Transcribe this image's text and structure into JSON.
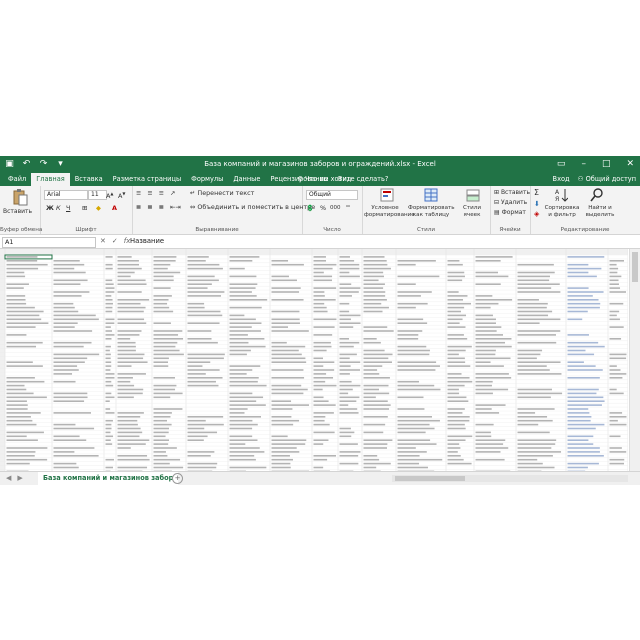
{
  "app": {
    "title": "База компаний и магазинов заборов и ограждений.xlsx - Excel",
    "quick_access": [
      "save",
      "undo",
      "redo",
      "more"
    ],
    "window_controls": [
      "ribbon-options",
      "minimize",
      "restore",
      "close"
    ]
  },
  "tabs": [
    "Файл",
    "Главная",
    "Вставка",
    "Разметка страницы",
    "Формулы",
    "Данные",
    "Рецензирование",
    "Вид"
  ],
  "active_tab": "Главная",
  "tell_me": "Что вы хотите сделать?",
  "account": {
    "signin": "Вход",
    "share": "Общий доступ"
  },
  "ribbon": {
    "clipboard": {
      "paste": "Вставить",
      "label": "Буфер обмена"
    },
    "font": {
      "name": "Arial",
      "size": "11",
      "bold": "Ж",
      "italic": "К",
      "underline": "Ч",
      "label": "Шрифт"
    },
    "alignment": {
      "wrap": "Перенести текст",
      "merge": "Объединить и поместить в центре",
      "label": "Выравнивание"
    },
    "number": {
      "format": "Общий",
      "percent": "%",
      "thousands": "000",
      "label": "Число"
    },
    "styles": {
      "conditional": "Условное форматирование",
      "as_table": "Форматировать как таблицу",
      "cell_styles": "Стили ячеек",
      "label": "Стили"
    },
    "cells": {
      "insert": "Вставить",
      "delete": "Удалить",
      "format": "Формат",
      "label": "Ячейки"
    },
    "editing": {
      "sum": "Σ",
      "sort": "Сортировка и фильтр",
      "find": "Найти и выделить",
      "label": "Редактирование"
    }
  },
  "formula_bar": {
    "name_box": "A1",
    "cancel": "✕",
    "enter": "✓",
    "fx": "fx",
    "value": "Название"
  },
  "sheet": {
    "tab": "База компаний и магазинов забор",
    "add": "+"
  },
  "colors": {
    "accent": "#217346",
    "ribbon_bg": "#f3f3f3",
    "grid_line": "#e2e2e2"
  }
}
